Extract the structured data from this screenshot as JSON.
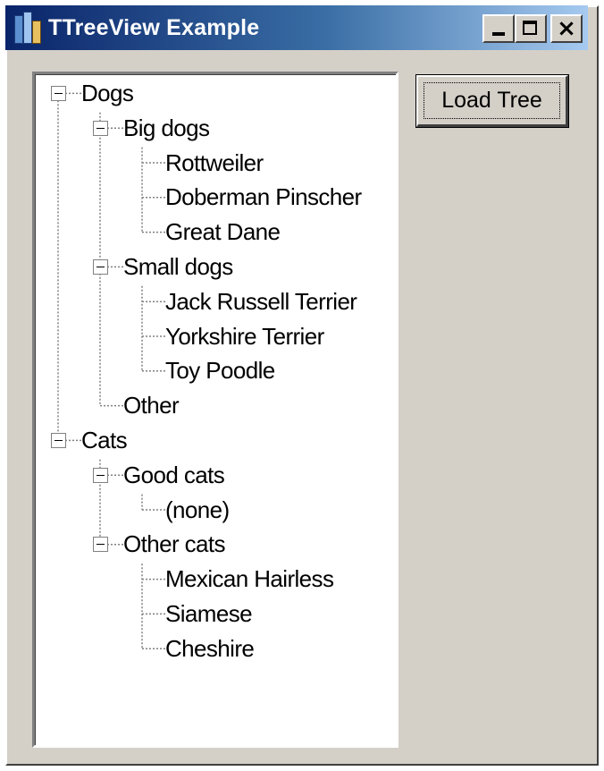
{
  "window": {
    "title": "TTreeView Example",
    "buttons": {
      "minimize": "minimize",
      "maximize": "maximize",
      "close": "×"
    }
  },
  "load_button": {
    "label": "Load Tree"
  },
  "tree": [
    {
      "label": "Dogs",
      "expanded": true,
      "children": [
        {
          "label": "Big dogs",
          "expanded": true,
          "children": [
            {
              "label": "Rottweiler"
            },
            {
              "label": "Doberman Pinscher"
            },
            {
              "label": "Great Dane"
            }
          ]
        },
        {
          "label": "Small dogs",
          "expanded": true,
          "children": [
            {
              "label": "Jack Russell Terrier"
            },
            {
              "label": "Yorkshire Terrier"
            },
            {
              "label": "Toy Poodle"
            }
          ]
        },
        {
          "label": "Other"
        }
      ]
    },
    {
      "label": "Cats",
      "expanded": true,
      "children": [
        {
          "label": "Good cats",
          "expanded": true,
          "children": [
            {
              "label": "(none)"
            }
          ]
        },
        {
          "label": "Other cats",
          "expanded": true,
          "children": [
            {
              "label": "Mexican Hairless"
            },
            {
              "label": "Siamese"
            },
            {
              "label": "Cheshire"
            }
          ]
        }
      ]
    }
  ],
  "colors": {
    "title_gradient_start": "#0a246a",
    "title_gradient_end": "#a6caf0",
    "face": "#d4d0c8",
    "tree_line": "#808080"
  }
}
